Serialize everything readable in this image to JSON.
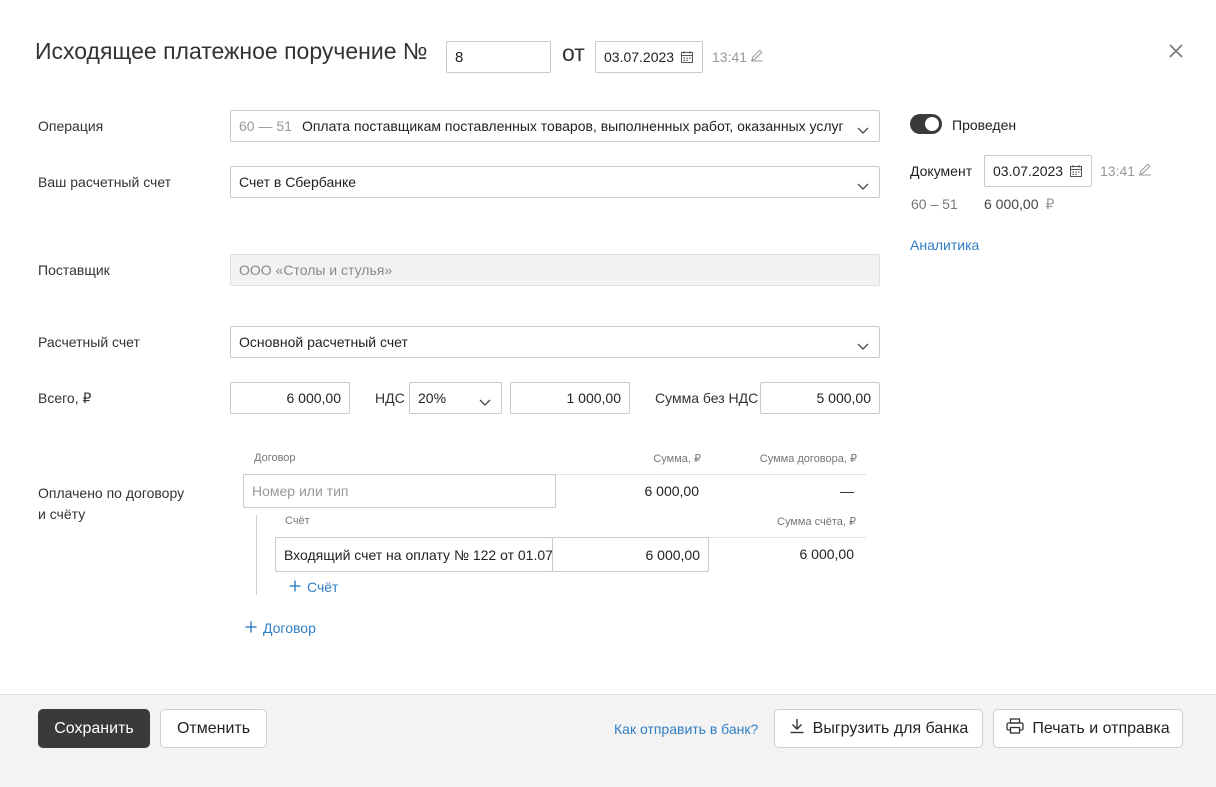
{
  "header": {
    "title": "Исходящее платежное поручение №",
    "number": "8",
    "ot_label": "от",
    "date": "03.07.2023",
    "time": "13:41"
  },
  "icons": [
    "calendar-icon",
    "pencil-icon",
    "close-icon",
    "chevron-down-icon",
    "plus-icon",
    "download-icon",
    "printer-icon"
  ],
  "form": {
    "operation_label": "Операция",
    "operation_code": "60 — 51",
    "operation_value": "Оплата поставщикам поставленных товаров, выполненных работ, оказанных услуг",
    "account_label": "Ваш расчетный счет",
    "account_value": "Счет в Сбербанке",
    "supplier_label": "Поставщик",
    "supplier_value": "ООО «Столы и стулья»",
    "settlement_label": "Расчетный счет",
    "settlement_value": "Основной расчетный счет",
    "total_label": "Всего, ₽",
    "total_value": "6 000,00",
    "vat_label": "НДС",
    "vat_rate": "20%",
    "vat_amount": "1 000,00",
    "no_vat_label": "Сумма без НДС",
    "no_vat_value": "5 000,00"
  },
  "payments": {
    "label_line1": "Оплачено по договору",
    "label_line2": "и счёту",
    "col_contract": "Договор",
    "col_sum": "Сумма, ₽",
    "col_contract_sum": "Сумма договора, ₽",
    "contract_placeholder": "Номер или тип",
    "contract_sum": "6 000,00",
    "contract_total": "—",
    "col_invoice": "Счёт",
    "col_invoice_sum": "Сумма счёта, ₽",
    "invoice_value": "Входящий счет на оплату № 122 от 01.07.",
    "invoice_sum": "6 000,00",
    "invoice_total": "6 000,00",
    "add_invoice": "Счёт",
    "add_contract": "Договор"
  },
  "sidebar": {
    "posted_label": "Проведен",
    "posted": true,
    "doc_label": "Документ",
    "doc_date": "03.07.2023",
    "doc_time": "13:41",
    "entry_code": "60 – 51",
    "entry_amount": "6 000,00",
    "currency": "₽",
    "analytics_link": "Аналитика"
  },
  "footer": {
    "save": "Сохранить",
    "cancel": "Отменить",
    "help_link": "Как отправить в банк?",
    "export": "Выгрузить для банка",
    "print": "Печать и отправка"
  },
  "colors": {
    "primary": "#3a3a3a",
    "link": "#2f7ec4",
    "muted": "#999999",
    "footer_bg": "#f3f3f3"
  }
}
